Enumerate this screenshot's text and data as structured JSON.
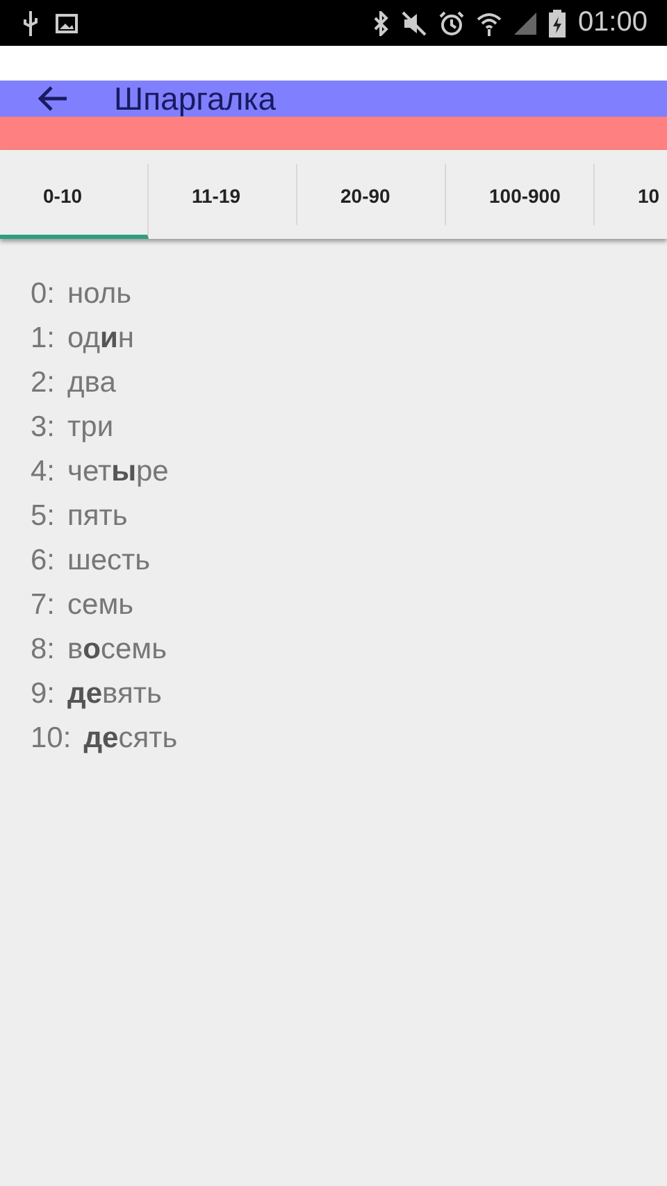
{
  "status_bar": {
    "time": "01:00"
  },
  "app_bar": {
    "title": "Шпаргалка"
  },
  "tabs": [
    {
      "label": "0-10",
      "selected": true
    },
    {
      "label": "11-19",
      "selected": false
    },
    {
      "label": "20-90",
      "selected": false
    },
    {
      "label": "100-900",
      "selected": false
    },
    {
      "label": "10",
      "selected": false
    }
  ],
  "numbers": [
    {
      "number": "0:",
      "word": "ноль"
    },
    {
      "number": "1:",
      "word": "од**и**н"
    },
    {
      "number": "2:",
      "word": "два"
    },
    {
      "number": "3:",
      "word": "три"
    },
    {
      "number": "4:",
      "word": "чет**ы**ре"
    },
    {
      "number": "5:",
      "word": "пять"
    },
    {
      "number": "6:",
      "word": "шесть"
    },
    {
      "number": "7:",
      "word": "семь"
    },
    {
      "number": "8:",
      "word": "в**о**семь"
    },
    {
      "number": "9:",
      "word": "**де**вять"
    },
    {
      "number": "10:",
      "word": "**де**сять"
    }
  ]
}
